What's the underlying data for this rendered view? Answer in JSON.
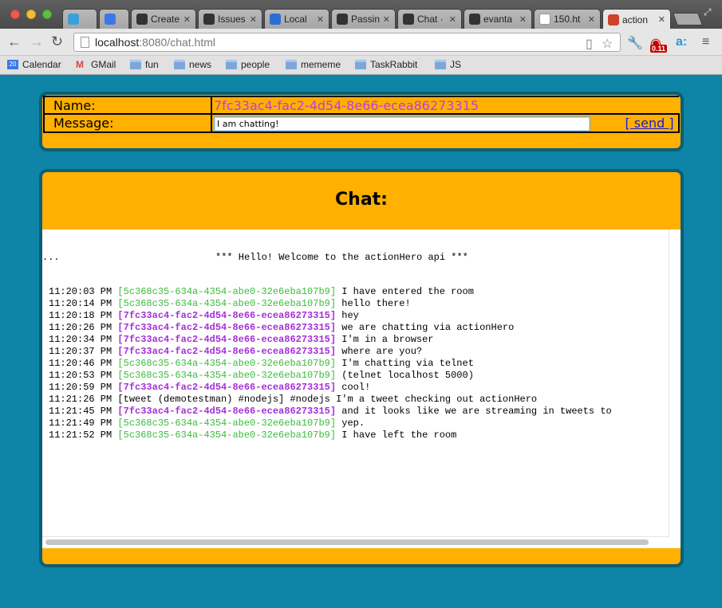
{
  "browser": {
    "tabs": [
      {
        "title": "",
        "icon": "actionhero-icon",
        "color": "#3aa0d8"
      },
      {
        "title": "",
        "icon": "calendar-icon",
        "color": "#3b78e7"
      },
      {
        "title": "Create",
        "icon": "github-icon",
        "color": "#333333"
      },
      {
        "title": "Issues",
        "icon": "github-icon",
        "color": "#333333"
      },
      {
        "title": "Local",
        "icon": "chat-icon",
        "color": "#2a6fd6"
      },
      {
        "title": "Passin",
        "icon": "github-icon",
        "color": "#333333"
      },
      {
        "title": "Chat ·",
        "icon": "github-icon",
        "color": "#333333"
      },
      {
        "title": "evanta",
        "icon": "github-icon",
        "color": "#333333"
      },
      {
        "title": "150.ht",
        "icon": "file-icon",
        "color": "#ffffff"
      },
      {
        "title": "action",
        "icon": "actionhero-icon",
        "color": "#d0412a"
      }
    ],
    "url_host": "localhost",
    "url_rest": ":8080/chat.html",
    "extension_badge": "0.11",
    "bookmarks": [
      {
        "label": "Calendar",
        "icon": "calendar-icon",
        "badge": "20"
      },
      {
        "label": "GMail",
        "icon": "gmail-icon"
      },
      {
        "label": "fun",
        "icon": "folder-icon"
      },
      {
        "label": "news",
        "icon": "folder-icon"
      },
      {
        "label": "people",
        "icon": "folder-icon"
      },
      {
        "label": "mememe",
        "icon": "folder-icon"
      },
      {
        "label": "TaskRabbit",
        "icon": "folder-icon"
      },
      {
        "label": "JS",
        "icon": "folder-icon"
      }
    ]
  },
  "form": {
    "name_label": "Name:",
    "name_value": "7fc33ac4-fac2-4d54-8e66-ecea86273315",
    "message_label": "Message:",
    "message_value": "I am chatting!",
    "send_label": "[ send ]"
  },
  "chat": {
    "title": "Chat:",
    "welcome_prefix": "...",
    "welcome": "*** Hello! Welcome to the actionHero api ***",
    "messages": [
      {
        "time": "11:20:03 PM",
        "user": "[5c368c35-634a-4354-abe0-32e6eba107b9]",
        "user_color": "green",
        "text": "I have entered the room"
      },
      {
        "time": "11:20:14 PM",
        "user": "[5c368c35-634a-4354-abe0-32e6eba107b9]",
        "user_color": "green",
        "text": "hello there!"
      },
      {
        "time": "11:20:18 PM",
        "user": "[7fc33ac4-fac2-4d54-8e66-ecea86273315]",
        "user_color": "purple",
        "text": "hey"
      },
      {
        "time": "11:20:26 PM",
        "user": "[7fc33ac4-fac2-4d54-8e66-ecea86273315]",
        "user_color": "purple",
        "text": "we are chatting via actionHero"
      },
      {
        "time": "11:20:34 PM",
        "user": "[7fc33ac4-fac2-4d54-8e66-ecea86273315]",
        "user_color": "purple",
        "text": "I'm in a browser"
      },
      {
        "time": "11:20:37 PM",
        "user": "[7fc33ac4-fac2-4d54-8e66-ecea86273315]",
        "user_color": "purple",
        "text": "where are you?"
      },
      {
        "time": "11:20:46 PM",
        "user": "[5c368c35-634a-4354-abe0-32e6eba107b9]",
        "user_color": "green",
        "text": "I'm chatting via telnet"
      },
      {
        "time": "11:20:53 PM",
        "user": "[5c368c35-634a-4354-abe0-32e6eba107b9]",
        "user_color": "green",
        "text": "(telnet localhost 5000)"
      },
      {
        "time": "11:20:59 PM",
        "user": "[7fc33ac4-fac2-4d54-8e66-ecea86273315]",
        "user_color": "purple",
        "text": "cool!"
      },
      {
        "time": "11:21:26 PM",
        "user": "[tweet (demotestman) #nodejs]",
        "user_color": "plain",
        "text": "#nodejs I'm a tweet checking out actionHero"
      },
      {
        "time": "11:21:45 PM",
        "user": "[7fc33ac4-fac2-4d54-8e66-ecea86273315]",
        "user_color": "purple",
        "text": "and it looks like we are streaming in tweets to"
      },
      {
        "time": "11:21:49 PM",
        "user": "[5c368c35-634a-4354-abe0-32e6eba107b9]",
        "user_color": "green",
        "text": "yep."
      },
      {
        "time": "11:21:52 PM",
        "user": "[5c368c35-634a-4354-abe0-32e6eba107b9]",
        "user_color": "green",
        "text": "I have left the room"
      }
    ]
  }
}
